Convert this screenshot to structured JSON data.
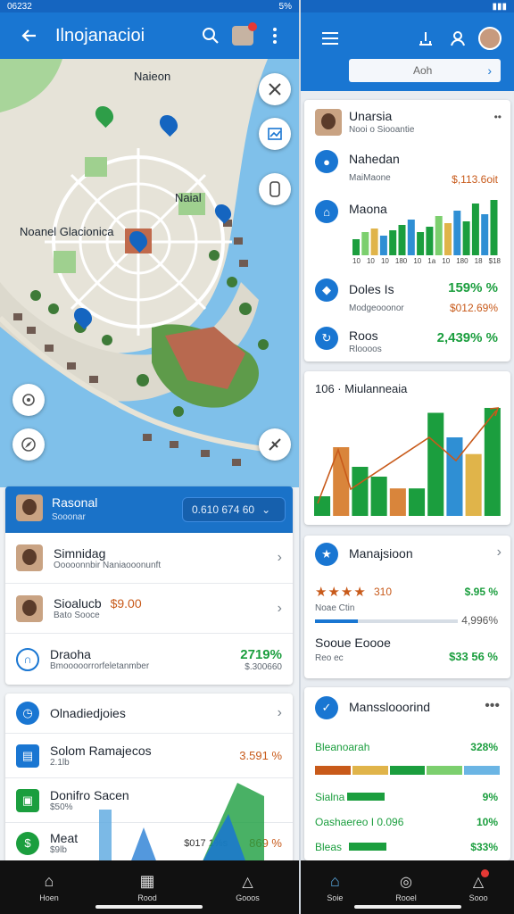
{
  "left": {
    "status": {
      "time": "06232",
      "battery": "5%"
    },
    "appbar": {
      "title": "Ilnojanacioi"
    },
    "map": {
      "labels": [
        "Naieon",
        "Naial",
        "Noanel Glacionica"
      ]
    },
    "profile": {
      "name": "Rasonal",
      "sub": "Sooonar",
      "pill": "0.610 674 60"
    },
    "list": [
      {
        "title": "Simnidag",
        "sub": "Ooooonnbir Naniaooonunft",
        "value": ""
      },
      {
        "title": "Sioalucb",
        "value": "$9.00",
        "sub": "Bato Sooce"
      },
      {
        "title": "Draoha",
        "sub": "Bmooooorrorfeletanmber",
        "value": "2719%",
        "value2": "$.300660"
      }
    ],
    "card2": {
      "title": "Olnadiedjoies",
      "rows": [
        {
          "title": "Solom Ramajecos",
          "sub": "2.1lb",
          "value": "3.591 %"
        },
        {
          "title": "Donifro Sacen",
          "sub": "$50%",
          "value": ""
        },
        {
          "title": "Meat",
          "sub": "$9lb",
          "value": "$017 1%s",
          "value2": "869 %"
        }
      ]
    },
    "nav": [
      "Hoen",
      "Rood",
      "Gooos"
    ]
  },
  "right": {
    "search_text": "Aoh",
    "card1": {
      "header": {
        "title": "Unarsia",
        "sub": "Nooi o Siooantie"
      },
      "rows": [
        {
          "title": "Nahedan",
          "sub": "MaiMaone",
          "value": "$,113.6oit"
        },
        {
          "title": "Maona"
        },
        {
          "title": "Doles Is",
          "sub": "Modgeooonor",
          "value": "159% %",
          "value2": "$012.69%"
        },
        {
          "title": "Roos",
          "sub": "Rloooos",
          "value": "2,439% %"
        }
      ],
      "chart_ticks": [
        "10",
        "10",
        "10",
        "180",
        "10",
        "1a",
        "10",
        "180",
        "18",
        "$18"
      ]
    },
    "chart2": {
      "label": "106 · Miulanneaia",
      "type": "bar",
      "bars": [
        {
          "color": "#1b9e3e",
          "value": 20
        },
        {
          "color": "#d9853b",
          "value": 70
        },
        {
          "color": "#1b9e3e",
          "value": 50
        },
        {
          "color": "#1b9e3e",
          "value": 40
        },
        {
          "color": "#d9853b",
          "value": 28
        },
        {
          "color": "#1b9e3e",
          "value": 28
        },
        {
          "color": "#1b9e3e",
          "value": 105
        },
        {
          "color": "#2f8fd4",
          "value": 80
        },
        {
          "color": "#e0b44a",
          "value": 63
        },
        {
          "color": "#1b9e3e",
          "value": 110
        }
      ]
    },
    "card3": {
      "title": "Manajsioon",
      "rating_value": "310",
      "rating_stars": 4,
      "value1": "$.95 %",
      "sub1": "Noae Ctin",
      "value2": "4,996%",
      "progress": 0.3,
      "row2_title": "Sooue Eoooe",
      "row2_sub": "Reo ec",
      "row2_value": "$33 56 %"
    },
    "card4": {
      "title": "Mansslooorind",
      "rows": [
        {
          "title": "Bleanoarah",
          "value": "328%"
        },
        {
          "title": "Sialna",
          "value": "9%",
          "bar": 0.35
        },
        {
          "title": "Oashaereo I 0.096",
          "value": "10%",
          "bar": 0.22
        },
        {
          "title": "Bleas",
          "value": "$33%",
          "bar": 0.35
        }
      ],
      "segment_colors": [
        "#c85a1a",
        "#e0b44a",
        "#1b9e3e",
        "#7ccf6e",
        "#6bb5e4"
      ]
    },
    "nav": [
      "Soie",
      "Rooel",
      "Sooo"
    ]
  },
  "colors": {
    "primary": "#1976d2",
    "dark_primary": "#1565c0",
    "green": "#1b9e3e",
    "orange": "#c85a1a"
  }
}
